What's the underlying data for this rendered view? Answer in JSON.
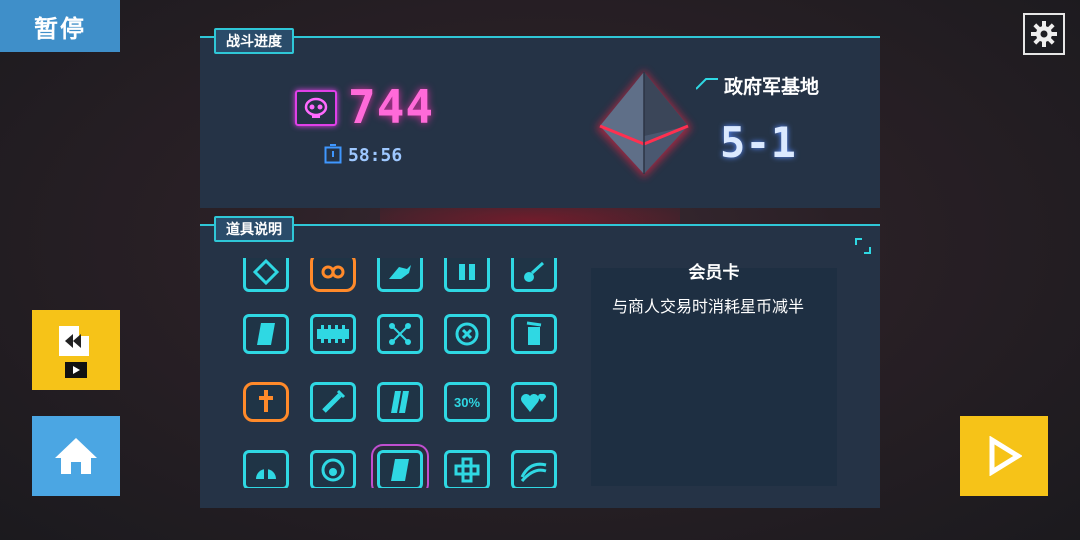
{
  "pause_label": "暂停",
  "battle_progress": {
    "tab_label": "战斗进度",
    "score": "744",
    "timer": "58:56",
    "area_name": "政府军基地",
    "stage": "5-1"
  },
  "items_panel": {
    "tab_label": "道具说明",
    "items": [
      {
        "icon": "diamond-arrows-icon",
        "style": "cyan"
      },
      {
        "icon": "infinity-shield-icon",
        "style": "orange"
      },
      {
        "icon": "bird-icon",
        "style": "cyan"
      },
      {
        "icon": "pause-bars-icon",
        "style": "cyan"
      },
      {
        "icon": "comet-icon",
        "style": "cyan"
      },
      {
        "icon": "card-icon",
        "style": "cyan"
      },
      {
        "icon": "chain-icon",
        "style": "cyan"
      },
      {
        "icon": "network-icon",
        "style": "cyan"
      },
      {
        "icon": "close-circle-icon",
        "style": "cyan"
      },
      {
        "icon": "battery-icon",
        "style": "cyan"
      },
      {
        "icon": "sword-hex-icon",
        "style": "orange"
      },
      {
        "icon": "syringe-icon",
        "style": "cyan"
      },
      {
        "icon": "split-card-icon",
        "style": "cyan"
      },
      {
        "icon": "up-30-percent-icon",
        "style": "cyan",
        "text": "30%"
      },
      {
        "icon": "hearts-icon",
        "style": "cyan"
      },
      {
        "icon": "helmet-icon",
        "style": "cyan"
      },
      {
        "icon": "circle-target-icon",
        "style": "cyan"
      },
      {
        "icon": "member-card-icon",
        "style": "cyan",
        "selected": true
      },
      {
        "icon": "dpad-icon",
        "style": "cyan"
      },
      {
        "icon": "wave-icon",
        "style": "cyan"
      }
    ],
    "selected_title": "会员卡",
    "selected_description": "与商人交易时消耗星币减半"
  },
  "colors": {
    "accent_cyan": "#2fd8e3",
    "score_pink": "#ff6ad9",
    "button_yellow": "#f6c318",
    "button_blue": "#4ba6e3"
  }
}
